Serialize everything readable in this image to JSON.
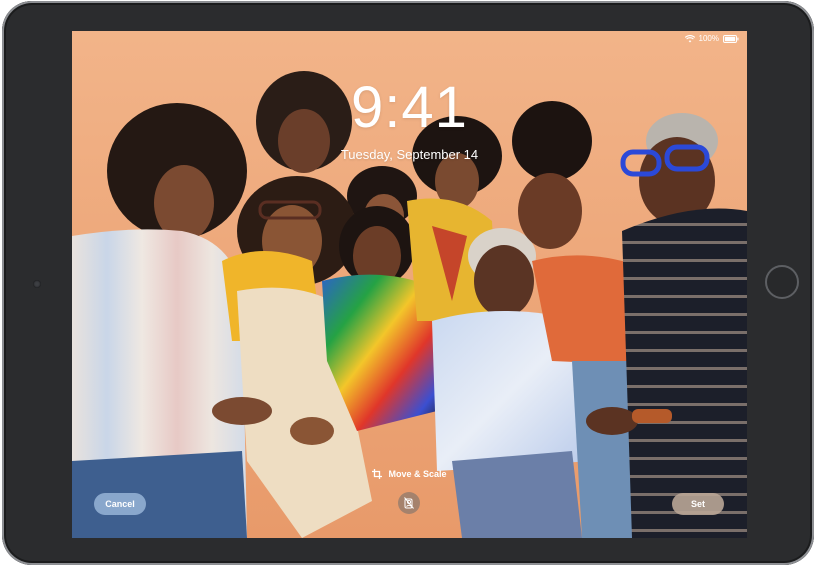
{
  "status_bar": {
    "battery_text": "100%",
    "wifi_icon": "wifi-icon",
    "battery_icon": "battery-icon"
  },
  "lock_screen": {
    "time": "9:41",
    "date": "Tuesday, September 14"
  },
  "controls": {
    "move_scale_label": "Move & Scale",
    "move_scale_icon": "crop-icon",
    "cancel_label": "Cancel",
    "set_label": "Set",
    "depth_effect_icon": "depth-effect-icon"
  },
  "colors": {
    "background": "#eea57a",
    "bezel": "#2b2c2e",
    "cancel_button": "#96b4d7",
    "set_button": "#b9a596"
  }
}
